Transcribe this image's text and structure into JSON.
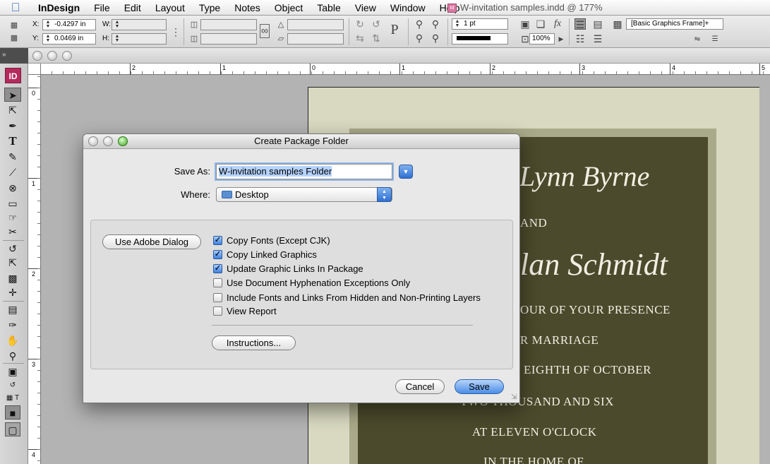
{
  "menubar": {
    "items": [
      "InDesign",
      "File",
      "Edit",
      "Layout",
      "Type",
      "Notes",
      "Object",
      "Table",
      "View",
      "Window",
      "Help"
    ]
  },
  "control_panel": {
    "x_label": "X:",
    "x_value": "-0.4297 in",
    "y_label": "Y:",
    "y_value": "0.0469 in",
    "w_label": "W:",
    "h_label": "H:",
    "stroke_weight": "1 pt",
    "zoom_percent": "100%",
    "object_style": "[Basic Graphics Frame]+"
  },
  "document": {
    "title": "W-invitation samples.indd @ 177%",
    "ruler_h_labels": [
      "2",
      "1",
      "0",
      "1",
      "2",
      "3",
      "4",
      "5"
    ],
    "ruler_v_labels": [
      "0",
      "1",
      "2",
      "3",
      "4"
    ],
    "invitation_lines": [
      "Lynn Byrne",
      "AND",
      "lan Schmidt",
      "OUR OF YOUR PRESENCE",
      "R MARRIAGE",
      "EIGHTH OF OCTOBER",
      "TWO THOUSAND AND SIX",
      "AT ELEVEN O'CLOCK",
      "IN THE HOME OF"
    ]
  },
  "tools_panel": {
    "logo": "ID"
  },
  "dialog": {
    "title": "Create Package Folder",
    "save_as_label": "Save As:",
    "save_as_value": "W-invitation samples Folder",
    "where_label": "Where:",
    "where_value": "Desktop",
    "use_adobe_dialog": "Use Adobe Dialog",
    "options": [
      {
        "label": "Copy Fonts (Except CJK)",
        "checked": true
      },
      {
        "label": "Copy Linked Graphics",
        "checked": true
      },
      {
        "label": "Update Graphic Links In Package",
        "checked": true
      },
      {
        "label": "Use Document Hyphenation Exceptions Only",
        "checked": false
      },
      {
        "label": "Include Fonts and Links From Hidden and Non-Printing Layers",
        "checked": false
      },
      {
        "label": "View Report",
        "checked": false
      }
    ],
    "instructions_button": "Instructions...",
    "cancel_button": "Cancel",
    "save_button": "Save"
  },
  "colors": {
    "accent": "#3f80dc",
    "invitation_panel": "#4b4a2c",
    "invitation_paper": "#d8d9c0"
  }
}
